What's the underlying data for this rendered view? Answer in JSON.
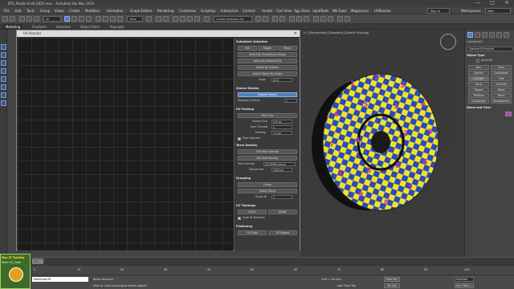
{
  "titlebar": {
    "title": "BTS_Paalke Endt_0020.max - Autodesk 3ds Max 2020",
    "minimize": "—",
    "maximize": "□",
    "close": "✕"
  },
  "menubar": {
    "items": [
      "File",
      "Edit",
      "Tools",
      "Group",
      "Views",
      "Create",
      "Modifiers",
      "Animation",
      "Graph Editors",
      "Rendering",
      "Customize",
      "Scripting",
      "Interactive",
      "Content",
      "Arnold",
      "Civil View",
      "App Store",
      "rapidTools",
      "Wk Tools",
      "Megascans",
      "UVReactor"
    ],
    "sign_in": "Sign In",
    "workspaces_label": "Workspaces:",
    "workspace_value": "Main"
  },
  "toolbar": {
    "selection_filter": "All",
    "view_dropdown": "View",
    "create_selection_set": "Create Selection Se"
  },
  "ribbon": {
    "tabs": [
      "Modeling",
      "Freeform",
      "Selection",
      "Object Paint",
      "Populate"
    ]
  },
  "uv_editor": {
    "title": "UV Reactor",
    "subobject_selection": {
      "header": "Subobject Selection",
      "btn_uvs": "UVs",
      "btn_edges": "Edges",
      "btn_faces": "Faces",
      "btn_smoothing": "Select By Smoothing Groups",
      "btn_material": "Select By Material IDs",
      "btn_by_system": "Select By System",
      "btn_by_angle": "Select Object By Angle",
      "angle_label": "Angle",
      "angle_value": "45.0"
    },
    "seams_display": {
      "header": "Seams Display",
      "btn_display_seams": "Display Seams",
      "mapping_channel_label": "Mapping Channel",
      "mapping_channel_value": "1"
    },
    "uv_packing": {
      "header": "UV Packing",
      "btn_pack": "Pack UVs",
      "packed_size_label": "Packed Size",
      "packed_size_value": "512 px",
      "num_threads_label": "Num Threads",
      "num_threads_value": "4",
      "padding_label": "Padding",
      "padding_value": "1.0 px",
      "pack_selected_label": "Pack Selected"
    },
    "texel_density": {
      "header": "Texel Density",
      "btn_get": "Get Texel Density",
      "btn_set": "Set Texel Density",
      "texel_density_label": "Texel Density",
      "texel_density_value": "25.39999 px/cm",
      "texture_res_label": "Texture Res",
      "texture_res_value": "1024 px"
    },
    "grouping": {
      "header": "Grouping",
      "btn_group": "Group",
      "btn_select_group": "Select Group",
      "group_id_label": "Group ID",
      "group_id_value": "1"
    },
    "uv_topology": {
      "header": "UV Topology",
      "btn_stitch": "Stitch",
      "btn_break": "Break",
      "snap_label": "Snap To Selection"
    },
    "flattening": {
      "header": "Flattening",
      "btn_by_grid": "Fill Grids",
      "btn_square": "Fill Square"
    }
  },
  "command_panel": {
    "object_name": "Cylinder001",
    "dropdown": "Standard Primitives",
    "object_type_header": "Object Type",
    "autogrid_label": "AutoGrid",
    "buttons": [
      "Box",
      "Cone",
      "Sphere",
      "GeoSphere",
      "Cylinder",
      "Tube",
      "Torus",
      "Pyramid",
      "Teapot",
      "Plane",
      "TextPlus",
      "Plane",
      "GeoSphere",
      "IQuadSphere"
    ],
    "name_color_header": "Name and Color"
  },
  "viewport": {
    "label": "[+] [Perspective] [Standard] [Default Shading]",
    "wheel_digits": [
      "1",
      "2",
      "3",
      "4",
      "5",
      "6",
      "7",
      "8",
      "9",
      "5",
      "7",
      "6",
      "5",
      "1",
      "2",
      "3",
      "8",
      "4"
    ],
    "colors": {
      "yellow": "#f0e12a",
      "blue": "#2b4bb6",
      "dark": "#181818"
    }
  },
  "timeline": {
    "frame_label": "0 / 100",
    "ticks": [
      "0",
      "10",
      "20",
      "30",
      "40",
      "50",
      "60",
      "70",
      "80",
      "90",
      "100"
    ]
  },
  "statusbar": {
    "maxscript_label": "MAXScript Mi.",
    "none_selected": "None Selected",
    "hint": "Click or click-and-drag to select objects",
    "grid": "Grid = 10.0cm",
    "add_time_tag": "Add Time Tag",
    "auto_key": "Auto Key",
    "set_key": "Set Key",
    "selected": "Selected",
    "key_filters": "Key Filters..."
  },
  "logo": {
    "line1": "Max 3T Training",
    "line2": "Teller CG_Code"
  }
}
